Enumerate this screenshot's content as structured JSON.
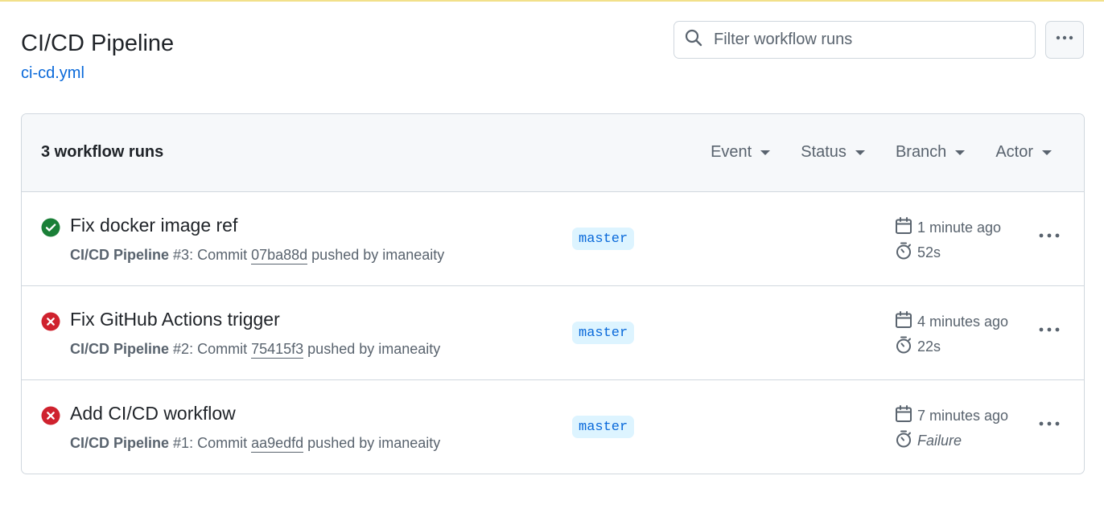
{
  "page": {
    "title": "CI/CD Pipeline",
    "file_link": "ci-cd.yml"
  },
  "search": {
    "placeholder": "Filter workflow runs",
    "value": ""
  },
  "runs_header": {
    "count_label": "3 workflow runs",
    "filters": [
      "Event",
      "Status",
      "Branch",
      "Actor"
    ]
  },
  "runs": [
    {
      "status": "success",
      "title": "Fix docker image ref",
      "workflow": "CI/CD Pipeline",
      "run_number": "#3",
      "commit_prefix": ": Commit ",
      "sha": "07ba88d",
      "pushed_by": " pushed by imaneaity",
      "branch": "master",
      "time_ago": "1 minute ago",
      "duration": "52s"
    },
    {
      "status": "failure",
      "title": "Fix GitHub Actions trigger",
      "workflow": "CI/CD Pipeline",
      "run_number": "#2",
      "commit_prefix": ": Commit ",
      "sha": "75415f3",
      "pushed_by": " pushed by imaneaity",
      "branch": "master",
      "time_ago": "4 minutes ago",
      "duration": "22s"
    },
    {
      "status": "failure",
      "title": "Add CI/CD workflow",
      "workflow": "CI/CD Pipeline",
      "run_number": "#1",
      "commit_prefix": ": Commit ",
      "sha": "aa9edfd",
      "pushed_by": " pushed by imaneaity",
      "branch": "master",
      "time_ago": "7 minutes ago",
      "duration": "Failure"
    }
  ],
  "colors": {
    "success": "#1a7f37",
    "failure": "#cf222e",
    "link": "#0969da",
    "muted": "#59636e"
  },
  "icons": {
    "search": "search-icon",
    "kebab": "kebab-horizontal-icon",
    "success": "check-circle-fill-icon",
    "failure": "x-circle-fill-icon",
    "calendar": "calendar-icon",
    "stopwatch": "stopwatch-icon"
  }
}
